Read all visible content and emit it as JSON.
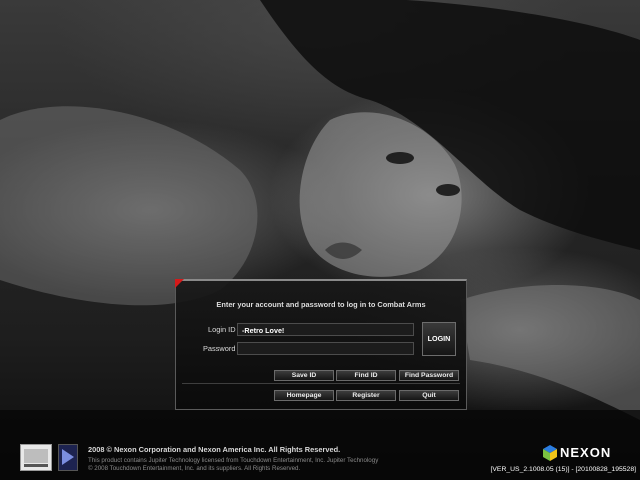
{
  "background": {
    "description_icon": "portrait-artwork"
  },
  "login_panel": {
    "instructions": "Enter your account and password to log in to Combat Arms",
    "login_id_label": "Login ID",
    "login_id_value": "-Retro Love!",
    "password_label": "Password",
    "password_value": "",
    "login_button": "LOGIN",
    "save_id_button": "Save ID",
    "find_id_button": "Find ID",
    "find_password_button": "Find Password",
    "homepage_button": "Homepage",
    "register_button": "Register",
    "quit_button": "Quit",
    "accent_color": "#d51a1a"
  },
  "footer": {
    "copyright_main": "2008 © Nexon Corporation and Nexon America Inc.  All Rights Reserved.",
    "copyright_tech": "This product contains Jupiter Technology licensed from Touchdown Entertainment, Inc. Jupiter Technology",
    "copyright_tech2": "© 2008 Touchdown Entertainment, Inc. and its suppliers.  All Rights Reserved.",
    "logo_text": "NEXON",
    "version": "[VER_US_2.1008.05 (15)] - [20100828_195528]"
  }
}
